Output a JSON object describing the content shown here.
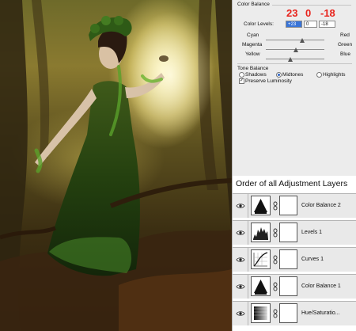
{
  "color_balance": {
    "title": "Color Balance",
    "levels_label": "Color Levels:",
    "levels": [
      "+23",
      "0",
      "-18"
    ],
    "callouts": [
      "23",
      "0",
      "-18"
    ],
    "callout_color": "#e8231c",
    "sliders": [
      {
        "left": "Cyan",
        "right": "Red"
      },
      {
        "left": "Magenta",
        "right": "Green"
      },
      {
        "left": "Yellow",
        "right": "Blue"
      }
    ]
  },
  "tone_balance": {
    "title": "Tone Balance",
    "options": [
      "Shadows",
      "Midtones",
      "Highlights"
    ],
    "selected": "Midtones",
    "preserve_label": "Preserve Luminosity",
    "preserve_checked": true
  },
  "layers": {
    "heading": "Order of all Adjustment Layers",
    "items": [
      {
        "name": "Color Balance 2",
        "icon": "color-balance-icon"
      },
      {
        "name": "Levels 1",
        "icon": "levels-histogram-icon"
      },
      {
        "name": "Curves 1",
        "icon": "curves-icon"
      },
      {
        "name": "Color Balance 1",
        "icon": "color-balance-icon"
      },
      {
        "name": "Hue/Saturatio...",
        "icon": "hue-saturation-icon"
      }
    ]
  }
}
